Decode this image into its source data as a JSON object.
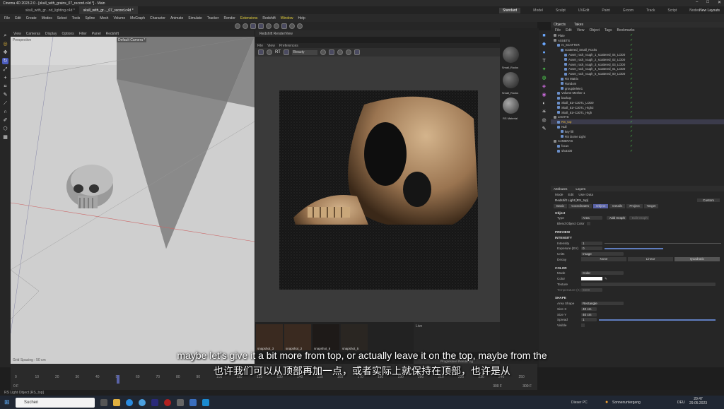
{
  "window": {
    "title": "Cinema 4D 2023.2.0 - [skull_with_grains_07_record.c4d *] - Main"
  },
  "doc_tabs": [
    "skull_with_gr...nd_lighting.c4d *",
    "skull_with_gr..._07_record.c4d *"
  ],
  "layouts": {
    "items": [
      "Standard",
      "Model",
      "Sculpt",
      "UVEdit",
      "Paint",
      "Groom",
      "Track",
      "Script",
      "Nodes"
    ],
    "new_layouts": "New Layouts"
  },
  "menu": [
    "File",
    "Edit",
    "Create",
    "Modes",
    "Select",
    "Tools",
    "Spline",
    "Mesh",
    "Volume",
    "MoGraph",
    "Character",
    "Animate",
    "Simulate",
    "Tracker",
    "Render",
    "Extensions",
    "Redshift",
    "Window",
    "Help"
  ],
  "viewport": {
    "menu": [
      "View",
      "Cameras",
      "Display",
      "Options",
      "Filter",
      "Panel",
      "Redshift"
    ],
    "label_tl": "Perspective",
    "label_tr": "Default Camera *",
    "status": "Grid Spacing : 50 cm"
  },
  "renderview": {
    "title": "Redshift RenderView",
    "menu": [
      "File",
      "View",
      "Preferences"
    ],
    "display_dropdown": "Beauty",
    "snapshots": [
      "snapshot_3",
      "snapshot_2",
      "snapshot_6",
      "snapshot_5"
    ],
    "live_label": "Live",
    "progress_label": "Progressive Rendering"
  },
  "materials": [
    {
      "label": "Small_Rocks"
    },
    {
      "label": "Small_Rocks"
    },
    {
      "label": "RS Material"
    }
  ],
  "objects_panel": {
    "tabs": [
      "Objects",
      "Takes"
    ],
    "menu": [
      "File",
      "Edit",
      "View",
      "Object",
      "Tags",
      "Bookmarks"
    ],
    "rows": [
      {
        "name": "Plate",
        "indent": 0
      },
      {
        "name": "ASSETS",
        "indent": 0
      },
      {
        "name": "rs_SCATTER",
        "indent": 1
      },
      {
        "name": "scattered_Small_Rocks",
        "indent": 2
      },
      {
        "name": "Asset_rock_rough_1_scattered_04_LOD0",
        "indent": 3
      },
      {
        "name": "Asset_rock_rough_2_scattered_02_LOD0",
        "indent": 3
      },
      {
        "name": "Asset_rock_rough_3_scattered_03_LOD0",
        "indent": 3
      },
      {
        "name": "Asset_rock_rough_4_scattered_01_LOD0",
        "indent": 3
      },
      {
        "name": "Asset_rock_rough_5_scattered_00_LOD0",
        "indent": 3
      },
      {
        "name": "RS Matrix",
        "indent": 2
      },
      {
        "name": "Random",
        "indent": 2
      },
      {
        "name": "groupdelete1",
        "indent": 2
      },
      {
        "name": "Volume Mesher 1",
        "indent": 1
      },
      {
        "name": "backup",
        "indent": 1
      },
      {
        "name": "Skull_51+C30T1_LOD0",
        "indent": 1
      },
      {
        "name": "Skull_51+C30T1_High2",
        "indent": 1
      },
      {
        "name": "Skull_51+C30T1_High",
        "indent": 1
      },
      {
        "name": "LIGHTS",
        "indent": 0
      },
      {
        "name": "RS_top",
        "indent": 1,
        "selected": true
      },
      {
        "name": "Null",
        "indent": 1
      },
      {
        "name": "key fill",
        "indent": 2
      },
      {
        "name": "RS Dome Light",
        "indent": 2
      },
      {
        "name": "CAMERAS",
        "indent": 0
      },
      {
        "name": "focus",
        "indent": 1
      },
      {
        "name": "shot100",
        "indent": 1
      }
    ]
  },
  "attributes": {
    "tabs": [
      "Attributes",
      "Layers"
    ],
    "menu": [
      "Mode",
      "Edit",
      "User Data"
    ],
    "object_title": "Redshift Light [RS_top]",
    "preset": "Custom",
    "subtabs": [
      "Basic",
      "Coordinates",
      "Object",
      "Details",
      "Project",
      "Target"
    ],
    "section_object": "Object",
    "type_label": "Type",
    "type_value": "Area",
    "add_graph": "Add Graph",
    "edit_graph": "Edit Graph",
    "blend_color": "Blend Object Color",
    "preview": "PREVIEW",
    "intensity_section": "INTENSITY",
    "intensity_label": "Intensity",
    "intensity_value": "1",
    "exposure_label": "Exposure (EV)",
    "exposure_value": "0",
    "units_label": "Units",
    "units_value": "Image",
    "decay_label": "Decay",
    "decay_options": [
      "None",
      "Linear",
      "Quadratic"
    ],
    "color_section": "COLOR",
    "mode_label": "Mode",
    "mode_value": "Color",
    "color_label": "Color",
    "texture_label": "Texture",
    "temperature_label": "Temperature (K)",
    "temperature_value": "6500",
    "shape_section": "SHAPE",
    "area_shape_label": "Area Shape",
    "area_shape_value": "Rectangle",
    "size_x_label": "Size X",
    "size_x_value": "40 cm",
    "size_y_label": "Size Y",
    "size_y_value": "40 cm",
    "spread_label": "Spread",
    "spread_value": "1",
    "visible_label": "Visible"
  },
  "timeline": {
    "ticks": [
      "0",
      "10",
      "20",
      "30",
      "40",
      "50",
      "60",
      "70",
      "80",
      "90",
      "100",
      "110",
      "120",
      "130",
      "140",
      "150",
      "160",
      "170",
      "180",
      "190",
      "200",
      "210",
      "220",
      "230",
      "240",
      "250"
    ],
    "frame_start": "0 F",
    "frame_end": "300 F",
    "frame_end2": "300 F"
  },
  "statusbar": "RS Light Object [RS_top]",
  "subtitles": {
    "en": "maybe let's give it a bit more from top, or actually leave it on the top, maybe from the",
    "zh": "也许我们可以从顶部再加一点，或者实际上就保持在顶部，也许是从"
  },
  "taskbar": {
    "search": "Suchen",
    "weather": "Sonnenuntergang",
    "location": "Dieser PC",
    "lang": "DEU",
    "time": "20:47",
    "date": "29.05.2023"
  }
}
